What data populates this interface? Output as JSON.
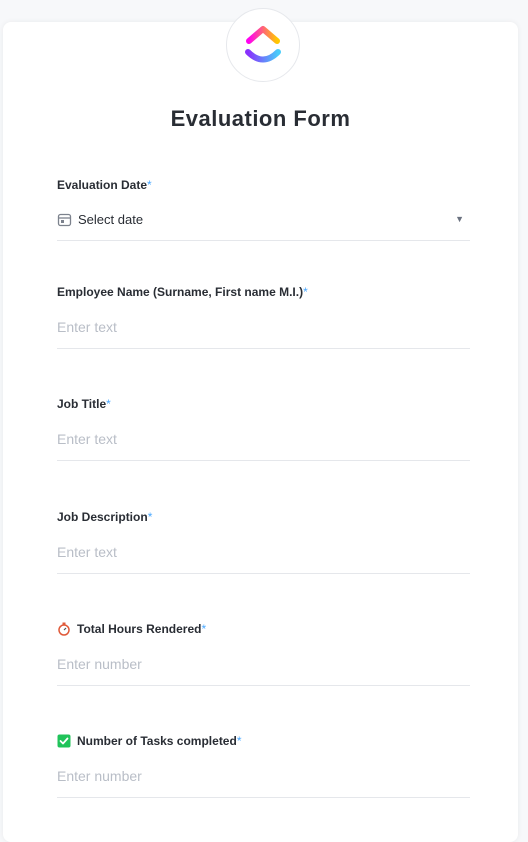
{
  "form": {
    "title": "Evaluation Form",
    "logo": "clickup-logo",
    "required_mark": "*",
    "fields": [
      {
        "label": "Evaluation Date",
        "type": "date",
        "value": "Select date",
        "icon": "calendar-icon"
      },
      {
        "label": "Employee Name (Surname, First name M.I.)",
        "type": "text",
        "placeholder": "Enter text"
      },
      {
        "label": "Job Title",
        "type": "text",
        "placeholder": "Enter text"
      },
      {
        "label": "Job Description",
        "type": "text",
        "placeholder": "Enter text"
      },
      {
        "label": "Total Hours Rendered",
        "type": "number",
        "placeholder": "Enter number",
        "icon": "stopwatch-icon"
      },
      {
        "label": "Number of Tasks completed",
        "type": "number",
        "placeholder": "Enter number",
        "icon": "checkbox-icon"
      }
    ]
  },
  "colors": {
    "accent": "#4aa8ff",
    "text": "#292d34",
    "placeholder": "#b9bec7",
    "check_green": "#20c35a"
  }
}
